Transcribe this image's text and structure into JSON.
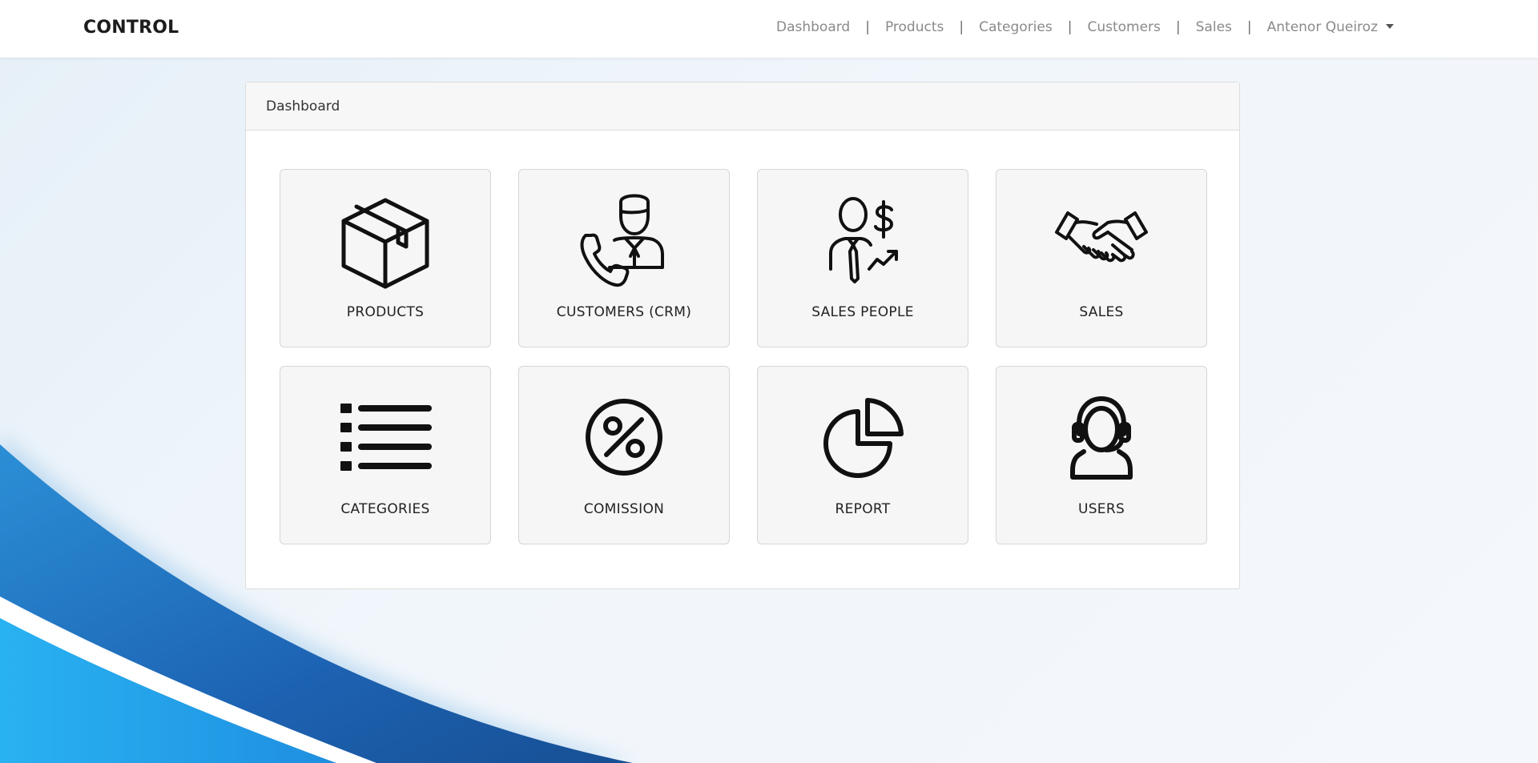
{
  "brand": "CONTROL",
  "nav": {
    "links": [
      "Dashboard",
      "Products",
      "Categories",
      "Customers",
      "Sales"
    ],
    "user": "Antenor Queiroz"
  },
  "panel": {
    "title": "Dashboard"
  },
  "tiles": [
    {
      "label": "PRODUCTS",
      "icon": "box-icon"
    },
    {
      "label": "CUSTOMERS (CRM)",
      "icon": "customer-service-icon"
    },
    {
      "label": "SALES PEOPLE",
      "icon": "salesperson-icon"
    },
    {
      "label": "SALES",
      "icon": "handshake-icon"
    },
    {
      "label": "CATEGORIES",
      "icon": "list-icon"
    },
    {
      "label": "COMISSION",
      "icon": "percent-icon"
    },
    {
      "label": "REPORT",
      "icon": "pie-chart-icon"
    },
    {
      "label": "USERS",
      "icon": "headset-user-icon"
    }
  ],
  "colors": {
    "wave_dark": "#1d63b3",
    "wave_light": "#2aa7ec",
    "background": "#eef4fa"
  }
}
